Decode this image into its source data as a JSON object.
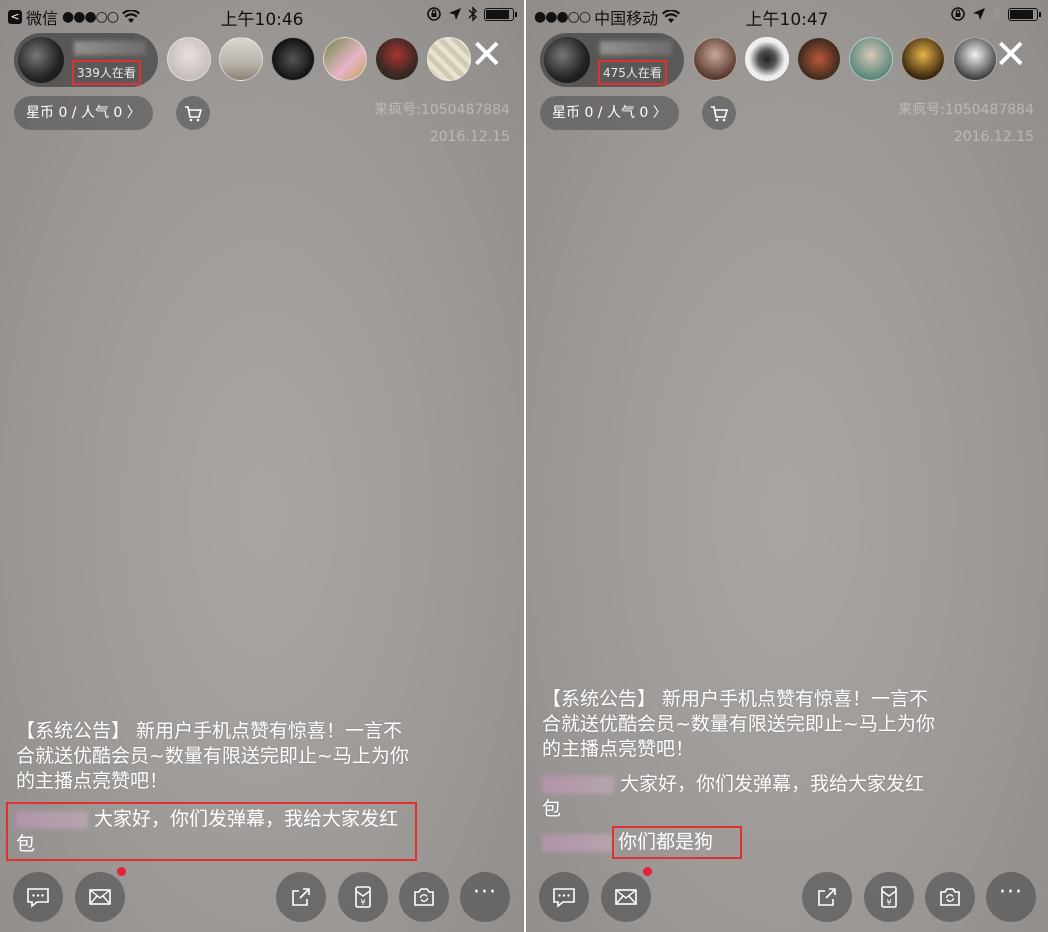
{
  "colors": {
    "highlight": "#e03030",
    "notification_dot": "#e3213b",
    "background": "#9c9896"
  },
  "left": {
    "status": {
      "back_icon": "back-arrow-icon",
      "carrier": "微信",
      "signal": "●●●○○",
      "time": "上午10:46"
    },
    "host": {
      "viewers": "339人在看"
    },
    "avatars": [
      "avatar-1",
      "avatar-2",
      "avatar-3",
      "avatar-4",
      "avatar-5",
      "avatar-6"
    ],
    "stats_label": "星币 0 / 人气 0 〉",
    "room_id": "来疯号:1050487884",
    "date": "2016.12.15",
    "announcement": "【系统公告】 新用户手机点赞有惊喜！一言不合就送优酷会员~数量有限送完即止~马上为你的主播点亮赞吧！",
    "message_text": "大家好，你们发弹幕，我给大家发红包"
  },
  "right": {
    "status": {
      "signal": "●●●○○",
      "carrier": "中国移动",
      "time": "上午10:47"
    },
    "host": {
      "viewers": "475人在看"
    },
    "avatars": [
      "avatar-1",
      "avatar-2",
      "avatar-3",
      "avatar-4",
      "avatar-5",
      "avatar-6"
    ],
    "stats_label": "星币 0 / 人气 0 〉",
    "room_id": "来疯号:1050487884",
    "date": "2016.12.15",
    "announcement": "【系统公告】 新用户手机点赞有惊喜！一言不合就送优酷会员~数量有限送完即止~马上为你的主播点亮赞吧！",
    "message1_text": "大家好，你们发弹幕，我给大家发红包",
    "message2_text": "你们都是狗"
  },
  "toolbar": [
    "chat-icon",
    "mail-icon",
    "share-icon",
    "red-envelope-icon",
    "camera-flip-icon",
    "more-icon"
  ]
}
